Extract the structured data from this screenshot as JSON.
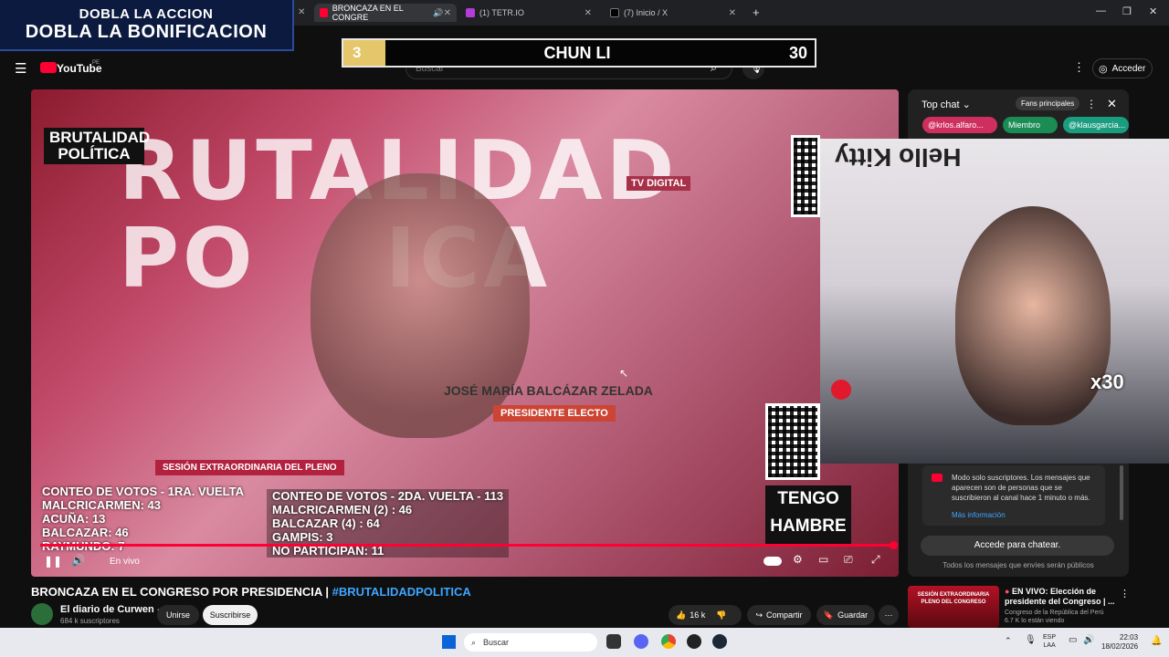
{
  "overlay": {
    "promo_line1": "DOBLA LA ACCION",
    "promo_line2": "DOBLA LA BONIFICACION",
    "rank": "3",
    "player": "CHUN LI",
    "score": "30"
  },
  "browser": {
    "tabs": [
      {
        "label": "BRONCAZA EN EL CONGRE",
        "active": true
      },
      {
        "label": "(1) TETR.IO",
        "active": false
      },
      {
        "label": "(7) Inicio / X",
        "active": false
      }
    ],
    "new_tab": "+"
  },
  "youtube": {
    "logo": "YouTube",
    "region": "PE",
    "search_placeholder": "Buscar",
    "signin": "Acceder"
  },
  "video": {
    "big_title": "RUTALIDAD\nPO    ICA",
    "logo_text": "BRUTALIDAD POLÍTICA",
    "sign_name": "JOSÉ MARÍA BALCÁZAR ZELADA",
    "sign_sub": "PRESIDENTE ELECTO",
    "session": "SESIÓN EXTRAORDINARIA DEL PLENO",
    "tv": "TV DIGITAL",
    "hungry_line1": "TENGO",
    "hungry_line2": "HAMBRE",
    "votes1": [
      "CONTEO DE VOTOS - 1RA. VUELTA",
      "MALCRICARMEN: 43",
      "ACUÑA: 13",
      "BALCAZAR: 46",
      "RAYMUNDO: 7"
    ],
    "votes2": [
      "CONTEO DE VOTOS - 2DA. VUELTA - 113",
      "MALCRICARMEN (2) : 46",
      "BALCAZAR (4) : 64",
      "GAMPIS: 3",
      "NO PARTICIPAN: 11"
    ],
    "live_label": "En vivo",
    "progress": 1.0
  },
  "webcam": {
    "wall_text": "Hello Kitty",
    "multiplier": "x30"
  },
  "chat": {
    "header": "Top chat",
    "fans_label": "Fans principales",
    "pills": [
      "@krlos.alfaro...",
      "Miembro",
      "@klausgarcia..."
    ],
    "notice": "Modo solo suscriptores. Los mensajes que aparecen son de personas que se suscribieron al canal hace 1 minuto o más.",
    "notice_link": "Más información",
    "chat_button": "Accede para chatear.",
    "public_note": "Todos los mensajes que envíes serán públicos"
  },
  "details": {
    "title": "BRONCAZA EN EL CONGRESO POR PRESIDENCIA | ",
    "hashtag": "#BRUTALIDADPOLITICA",
    "channel": "El diario de Curwen",
    "subscribers": "684 k suscriptores",
    "join": "Unirse",
    "subscribe": "Suscribirse",
    "likes": "16 k",
    "share": "Compartir",
    "save": "Guardar"
  },
  "related": {
    "thumb_text": "SESIÓN EXTRAORDINARIA\nPLENO DEL CONGRESO",
    "title": "EN VIVO:  Elección de presidente del Congreso | ...",
    "channel": "Congreso de la República del Perú",
    "viewers": "6.7 K lo están viendo"
  },
  "taskbar": {
    "search": "Buscar",
    "lang1": "ESP",
    "lang2": "LAA",
    "time": "22:03",
    "date": "18/02/2026"
  }
}
